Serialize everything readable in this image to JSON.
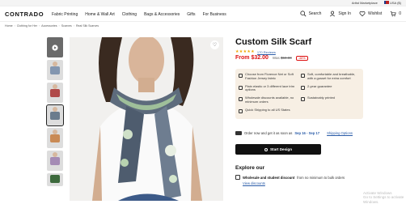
{
  "topbar": {
    "artist": "Artist Marketplace",
    "region": "USA ($)"
  },
  "header": {
    "logo": "CONTRADO",
    "nav": [
      "Fabric Printing",
      "Home & Wall Art",
      "Clothing",
      "Bags & Accessories",
      "Gifts",
      "For Business"
    ],
    "search": "Search",
    "signin": "Sign In",
    "wishlist": "Wishlist",
    "cart_count": "0"
  },
  "breadcrumbs": [
    "Home",
    "Clothing for Her",
    "Accessories",
    "Scarves",
    "Real Silk Scarves"
  ],
  "product": {
    "title": "Custom Silk Scarf",
    "stars": "★★★★★",
    "reviews": "170 Reviews",
    "price": "From $32.00",
    "was_label": "Was",
    "was_price": "$59.00",
    "discount": "-46%"
  },
  "features": [
    "Choose from Florence Net or Soft Fashion Jersey fabric",
    "Soft, comfortable and breathable, with a gusset for extra comfort",
    "Plain elastic or 3 different lace trim options",
    "2-year guarantee",
    "Wholesale discounts available, no minimum orders",
    "Sustainably printed",
    "Quick Shipping to all US States",
    ""
  ],
  "delivery": {
    "text": "Order now and get it as soon as",
    "dates": "Sep 16 - Sep 17",
    "link": "Shipping Options"
  },
  "cta": "Start Design",
  "explore": {
    "title": "Explore our",
    "ws_bold": "Wholesale and student discount",
    "ws_rest": "from no minimum to bulk orders",
    "link": "View discounts"
  },
  "watermark": {
    "line1": "Activate Windows",
    "line2": "Go to Settings to activate Windows."
  },
  "colors": {
    "price": "#dd1111",
    "link": "#2a5ca8",
    "features_bg": "#f7efe4",
    "cta_bg": "#111111"
  }
}
